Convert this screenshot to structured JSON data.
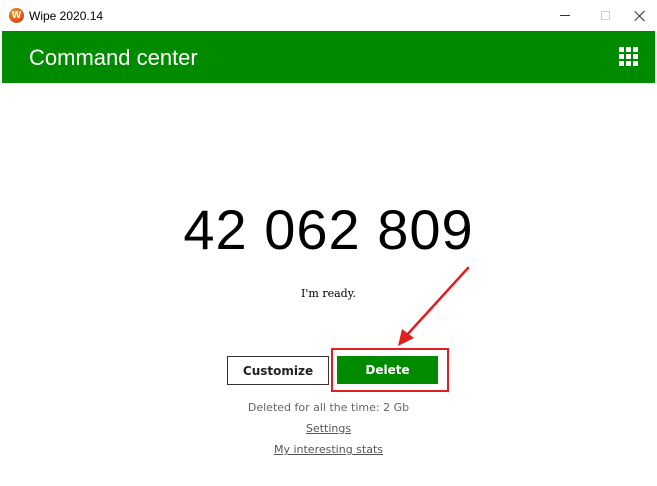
{
  "window": {
    "title": "Wipe 2020.14",
    "app_icon_glyph": "W"
  },
  "header": {
    "title": "Command center",
    "menu_icon": "grid-icon"
  },
  "main": {
    "counter": "42 062 809",
    "status": "I'm ready.",
    "customize_label": "Customize",
    "delete_label": "Delete",
    "deleted_total": "Deleted for all the time: 2 Gb",
    "settings_link": "Settings",
    "stats_link": "My interesting stats"
  },
  "colors": {
    "accent_green": "#008a00",
    "annotation_red": "#e02020"
  }
}
